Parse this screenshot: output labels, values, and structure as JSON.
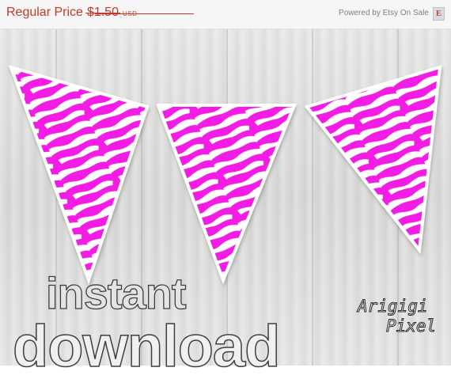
{
  "price_banner": {
    "label": "Regular Price",
    "value": "$1.50",
    "currency": "USD",
    "powered_by": "Powered by Etsy On Sale",
    "badge_letter": "E"
  },
  "product": {
    "headline_line1": "instant",
    "headline_line2": "download",
    "logo_line1": "Arigigi",
    "logo_line2": "Pixel",
    "colors": {
      "zebra_pink": "#f21fe4",
      "zebra_white": "#ffffff",
      "price_red": "#c0392b",
      "wood": "#dfdfde"
    }
  }
}
